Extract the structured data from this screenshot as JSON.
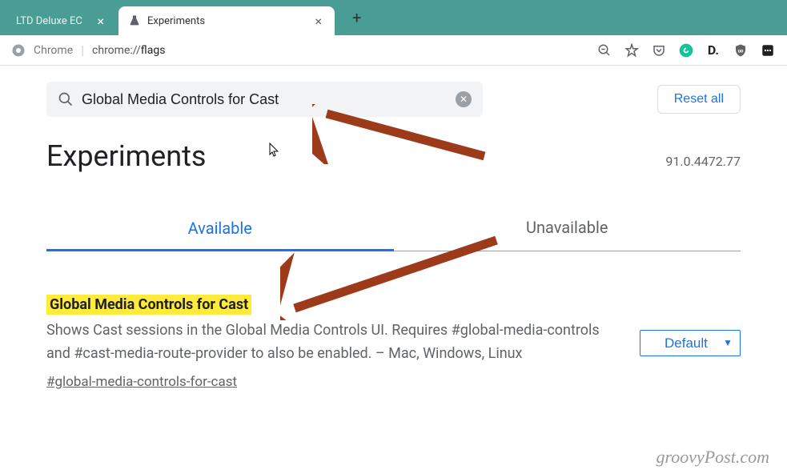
{
  "tabs": {
    "inactive": {
      "title": "LTD Deluxe EC"
    },
    "active": {
      "title": "Experiments"
    }
  },
  "addressBar": {
    "label": "Chrome",
    "urlPrefix": "chrome://",
    "urlPath": "flags"
  },
  "search": {
    "value": "Global Media Controls for Cast"
  },
  "resetLabel": "Reset all",
  "pageTitle": "Experiments",
  "version": "91.0.4472.77",
  "contentTabs": {
    "available": "Available",
    "unavailable": "Unavailable"
  },
  "flag": {
    "title": "Global Media Controls for Cast",
    "description": "Shows Cast sessions in the Global Media Controls UI. Requires #global-media-controls and #cast-media-route-provider to also be enabled. – Mac, Windows, Linux",
    "anchor": "#global-media-controls-for-cast",
    "selectValue": "Default"
  },
  "watermark": "groovyPost.com",
  "arrowColor": "#9c3a1a"
}
